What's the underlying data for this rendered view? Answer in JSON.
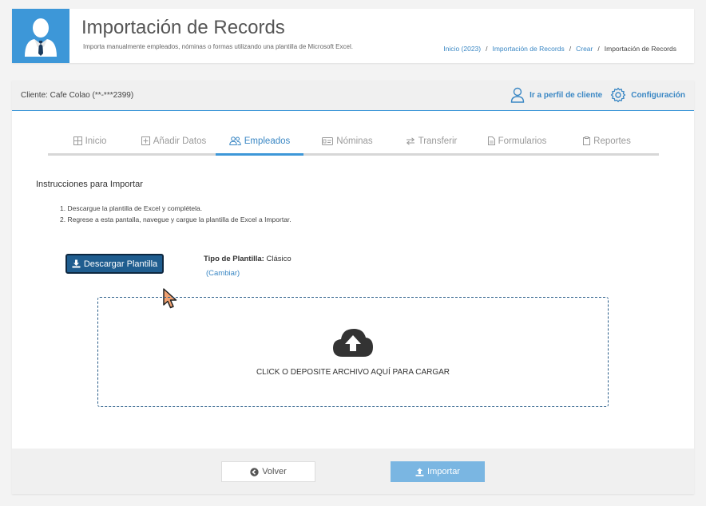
{
  "header": {
    "title": "Importación de Records",
    "subtitle": "Importa manualmente empleados, nóminas o formas utilizando una plantilla de Microsoft Excel.",
    "breadcrumb": [
      {
        "label": "Inicio (2023)"
      },
      {
        "label": "Importación de Records"
      },
      {
        "label": "Crear"
      },
      {
        "label": "Importación de Records"
      }
    ]
  },
  "client_bar": {
    "client_label": "Cliente: Cafe Colao (**-***2399)",
    "profile_link": "Ir a perfil de cliente",
    "settings_link": "Configuración"
  },
  "tabs": [
    {
      "label": "Inicio",
      "icon": "grid-icon"
    },
    {
      "label": "Añadir Datos",
      "icon": "plus-square-icon"
    },
    {
      "label": "Empleados",
      "icon": "users-icon",
      "active": true
    },
    {
      "label": "Nóminas",
      "icon": "id-card-icon"
    },
    {
      "label": "Transferir",
      "icon": "exchange-icon"
    },
    {
      "label": "Formularios",
      "icon": "file-icon"
    },
    {
      "label": "Reportes",
      "icon": "clipboard-icon"
    }
  ],
  "instructions": {
    "title": "Instrucciones para Importar",
    "steps": [
      "Descargue la plantilla de Excel y complétela.",
      "Regrese a esta pantalla, navegue y cargue la plantilla de Excel a Importar."
    ]
  },
  "download": {
    "button_label": "Descargar Plantilla",
    "template_type_label": "Tipo de Plantilla:",
    "template_type_value": "Clásico",
    "change_link": "(Cambiar)"
  },
  "dropzone": {
    "text": "CLICK O DEPOSITE ARCHIVO AQUÍ PARA CARGAR",
    "icon": "cloud-upload-icon"
  },
  "footer": {
    "back_label": "Volver",
    "import_label": "Importar"
  },
  "colors": {
    "accent": "#3d97d8",
    "link": "#3a87c4",
    "download_button": "#1f5d8f",
    "import_button": "#7ab6e2"
  }
}
